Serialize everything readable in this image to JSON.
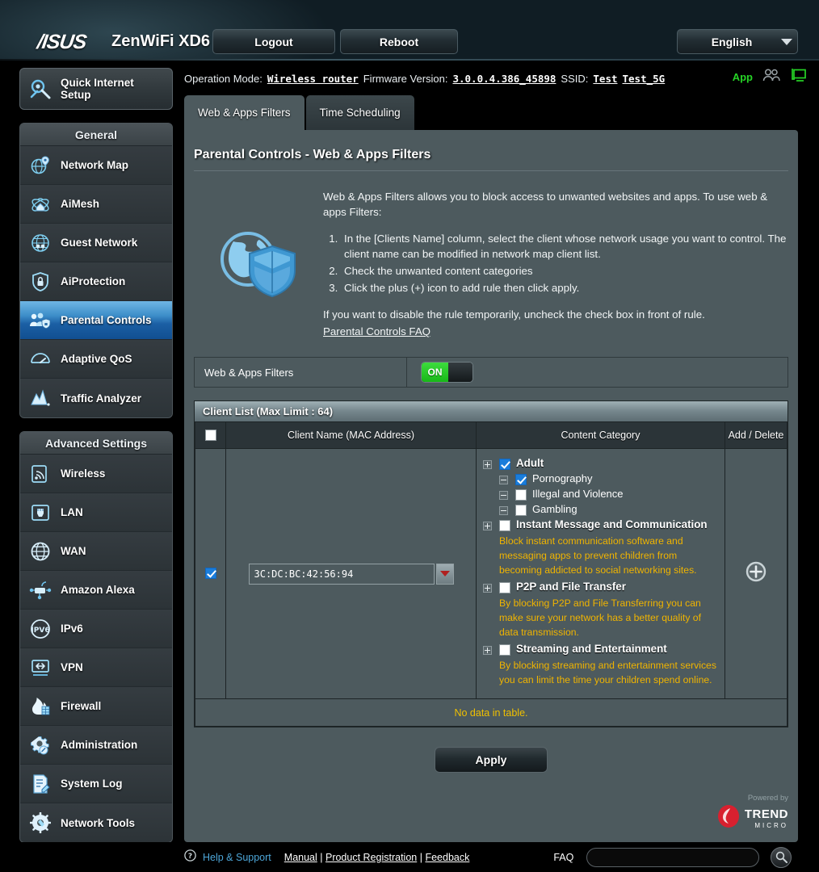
{
  "header": {
    "brand": "/ISUS",
    "model": "ZenWiFi XD6",
    "logout": "Logout",
    "reboot": "Reboot",
    "language": "English"
  },
  "info": {
    "operation_mode_label": "Operation Mode:",
    "operation_mode_value": "Wireless router",
    "firmware_label": "Firmware Version:",
    "firmware_value": "3.0.0.4.386_45898",
    "ssid_label": "SSID:",
    "ssid_1": "Test",
    "ssid_2": "Test_5G",
    "app_label": "App"
  },
  "sidebar": {
    "quick_setup": "Quick Internet Setup",
    "general_title": "General",
    "general_items": [
      {
        "label": "Network Map",
        "icon": "network-map-icon",
        "active": false
      },
      {
        "label": "AiMesh",
        "icon": "aimesh-icon",
        "active": false
      },
      {
        "label": "Guest Network",
        "icon": "guest-network-icon",
        "active": false
      },
      {
        "label": "AiProtection",
        "icon": "aiprotection-icon",
        "active": false
      },
      {
        "label": "Parental Controls",
        "icon": "parental-controls-icon",
        "active": true
      },
      {
        "label": "Adaptive QoS",
        "icon": "adaptive-qos-icon",
        "active": false
      },
      {
        "label": "Traffic Analyzer",
        "icon": "traffic-analyzer-icon",
        "active": false
      }
    ],
    "advanced_title": "Advanced Settings",
    "advanced_items": [
      {
        "label": "Wireless",
        "icon": "wireless-icon"
      },
      {
        "label": "LAN",
        "icon": "lan-icon"
      },
      {
        "label": "WAN",
        "icon": "wan-icon"
      },
      {
        "label": "Amazon Alexa",
        "icon": "amazon-alexa-icon"
      },
      {
        "label": "IPv6",
        "icon": "ipv6-icon"
      },
      {
        "label": "VPN",
        "icon": "vpn-icon"
      },
      {
        "label": "Firewall",
        "icon": "firewall-icon"
      },
      {
        "label": "Administration",
        "icon": "administration-icon"
      },
      {
        "label": "System Log",
        "icon": "system-log-icon"
      },
      {
        "label": "Network Tools",
        "icon": "network-tools-icon"
      }
    ]
  },
  "main": {
    "tabs": [
      {
        "label": "Web & Apps Filters",
        "active": true
      },
      {
        "label": "Time Scheduling",
        "active": false
      }
    ],
    "page_title": "Parental Controls - Web & Apps Filters",
    "intro_paragraph": "Web & Apps Filters allows you to block access to unwanted websites and apps. To use web & apps Filters:",
    "steps": [
      "In the [Clients Name] column, select the client whose network usage you want to control. The client name can be modified in network map client list.",
      "Check the unwanted content categories",
      "Click the plus (+) icon to add rule then click apply."
    ],
    "note": "If you want to disable the rule temporarily, uncheck the check box in front of rule.",
    "faq_link": "Parental Controls FAQ",
    "filter_toggle_label": "Web & Apps Filters",
    "filter_toggle_state": "ON",
    "client_list_title": "Client List (Max Limit : 64)",
    "columns": {
      "select": "",
      "client_name": "Client Name (MAC Address)",
      "content_category": "Content Category",
      "add_delete": "Add / Delete"
    },
    "row": {
      "selected": true,
      "mac_address": "3C:DC:BC:42:56:94",
      "add_icon": "plus-circle-icon"
    },
    "categories": [
      {
        "label": "Adult",
        "checked": true,
        "expander": "plus",
        "level": 1,
        "desc": "",
        "children": [
          {
            "label": "Pornography",
            "checked": true,
            "expander": "minus",
            "level": 2
          },
          {
            "label": "Illegal and Violence",
            "checked": false,
            "expander": "minus",
            "level": 2
          },
          {
            "label": "Gambling",
            "checked": false,
            "expander": "minus",
            "level": 2
          }
        ]
      },
      {
        "label": "Instant Message and Communication",
        "checked": false,
        "expander": "plus",
        "level": 1,
        "desc": "Block instant communication software and messaging apps to prevent children from becoming addicted to social networking sites.",
        "children": []
      },
      {
        "label": "P2P and File Transfer",
        "checked": false,
        "expander": "plus",
        "level": 1,
        "desc": "By blocking P2P and File Transferring you can make sure your network has a better quality of data transmission.",
        "children": []
      },
      {
        "label": "Streaming and Entertainment",
        "checked": false,
        "expander": "plus",
        "level": 1,
        "desc": "By blocking streaming and entertainment services you can limit the time your children spend online.",
        "children": []
      }
    ],
    "no_data": "No data in table.",
    "apply_label": "Apply",
    "powered_by": "Powered by",
    "trend_name": "TREND",
    "trend_sub": "MICRO"
  },
  "footer": {
    "help": "Help & Support",
    "manual": "Manual",
    "product_registration": "Product Registration",
    "feedback": "Feedback",
    "separator": " | ",
    "faq": "FAQ",
    "faq_placeholder": ""
  },
  "colors": {
    "accent_blue": "#1a7ddb",
    "panel_bg": "#4d5a5e",
    "toggle_on_green": "#18b818",
    "desc_yellow": "#f0b400",
    "app_green": "#26d426"
  }
}
